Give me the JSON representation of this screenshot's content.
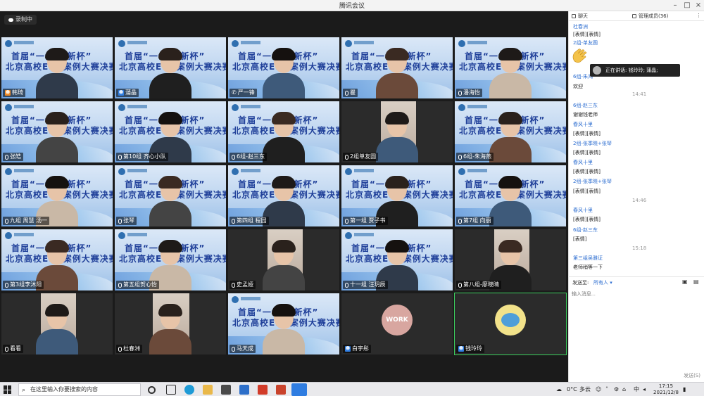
{
  "window": {
    "title": "腾讯会议"
  },
  "recording": {
    "label": "录制中"
  },
  "participants": [
    {
      "id": "t1",
      "name": "韩琦",
      "bg": "banner",
      "icon": "user-orange"
    },
    {
      "id": "t2",
      "name": "蒲晶",
      "bg": "banner",
      "icon": "user-blue"
    },
    {
      "id": "t3",
      "name": "严一锋",
      "bg": "banner",
      "icon": "phone"
    },
    {
      "id": "t4",
      "name": "瞿",
      "bg": "banner",
      "icon": "mic"
    },
    {
      "id": "t5",
      "name": "潘海怡",
      "bg": "banner",
      "icon": "mic"
    },
    {
      "id": "t6",
      "name": "张皓",
      "bg": "banner",
      "icon": "mic"
    },
    {
      "id": "t7",
      "name": "第10组 齐心小队",
      "bg": "banner",
      "icon": "mic"
    },
    {
      "id": "t8",
      "name": "6组-赵三东",
      "bg": "banner",
      "icon": "mic"
    },
    {
      "id": "t9",
      "name": "2组单友圆",
      "bg": "dark",
      "icon": "mic"
    },
    {
      "id": "t10",
      "name": "6组-朱海燕",
      "bg": "banner",
      "icon": "mic"
    },
    {
      "id": "t11",
      "name": "九组  周慧  汤一",
      "bg": "banner",
      "icon": "mic"
    },
    {
      "id": "t12",
      "name": "张琴",
      "bg": "banner",
      "icon": "mic"
    },
    {
      "id": "t13",
      "name": "第四组 程园",
      "bg": "banner",
      "icon": "mic"
    },
    {
      "id": "t14",
      "name": "第一组  贾子书",
      "bg": "banner",
      "icon": "mic"
    },
    {
      "id": "t15",
      "name": "第7组 向丽",
      "bg": "banner",
      "icon": "mic"
    },
    {
      "id": "t16",
      "name": "第3组李沐阳",
      "bg": "banner",
      "icon": "mic"
    },
    {
      "id": "t17",
      "name": "第五组贺心怡",
      "bg": "banner",
      "icon": "mic"
    },
    {
      "id": "t18",
      "name": "史孟娅",
      "bg": "dark",
      "icon": "mic"
    },
    {
      "id": "t19",
      "name": "十一组 汪玥辰",
      "bg": "banner",
      "icon": "mic"
    },
    {
      "id": "t20",
      "name": "第八组-廖晓晴",
      "bg": "dark",
      "icon": "mic"
    },
    {
      "id": "t21",
      "name": "看看",
      "bg": "dark",
      "icon": "mic"
    },
    {
      "id": "t22",
      "name": "杜春洲",
      "bg": "dark",
      "icon": "mic"
    },
    {
      "id": "t23",
      "name": "马天成",
      "bg": "banner",
      "icon": "mic"
    },
    {
      "id": "t24",
      "name": "白宇彤",
      "bg": "dark",
      "icon": "user-blue"
    },
    {
      "id": "t25",
      "name": "钱玲玲",
      "bg": "dark",
      "icon": "user-blue"
    }
  ],
  "banner": {
    "line1": "首届“一创·创新杯”",
    "line2": "北京高校ESG案例大赛决赛"
  },
  "avatars": {
    "work_text": "WORK"
  },
  "chat": {
    "tab_chat": "聊天",
    "tab_members": "管理成员(36)",
    "speaking_popup": "正在讲话: 钱玲玲; 蒲晶;",
    "lines": [
      {
        "type": "sender",
        "text": "杜春洲"
      },
      {
        "type": "msg",
        "text": "[表情][表情]"
      },
      {
        "type": "sender",
        "text": "2组-单友圆"
      },
      {
        "type": "sender",
        "text": "6组-朱鸿"
      },
      {
        "type": "msg",
        "text": "欢迎"
      },
      {
        "type": "time",
        "text": "14:41"
      },
      {
        "type": "sender",
        "text": "6组-赵三东"
      },
      {
        "type": "msg",
        "text": "谢谢钱老师"
      },
      {
        "type": "sender",
        "text": "春风十里"
      },
      {
        "type": "msg",
        "text": "[表情][表情]"
      },
      {
        "type": "sender",
        "text": "2组-张季晓+张琴"
      },
      {
        "type": "msg",
        "text": "[表情][表情]"
      },
      {
        "type": "sender",
        "text": "春风十里"
      },
      {
        "type": "msg",
        "text": "[表情][表情]"
      },
      {
        "type": "sender",
        "text": "2组-张季晓+张琴"
      },
      {
        "type": "msg",
        "text": "[表情][表情]"
      },
      {
        "type": "time",
        "text": "14:46"
      },
      {
        "type": "sender",
        "text": "春风十里"
      },
      {
        "type": "msg",
        "text": "[表情][表情]"
      },
      {
        "type": "sender",
        "text": "6组-赵三东"
      },
      {
        "type": "msg",
        "text": "[表情]"
      },
      {
        "type": "time",
        "text": "15:18"
      },
      {
        "type": "sender",
        "text": "第三组吴雅证"
      },
      {
        "type": "msg",
        "text": "老师稍等一下"
      }
    ],
    "send_to_label": "发送至:",
    "send_to_value": "所有人",
    "input_placeholder": "输入消息...",
    "send_button": "发送(S)"
  },
  "taskbar": {
    "search_placeholder": "在这里输入你要搜索的内容",
    "weather_temp": "0°C",
    "weather_desc": "多云",
    "ime": "中",
    "time": "17:15",
    "date": "2021/12/8"
  }
}
